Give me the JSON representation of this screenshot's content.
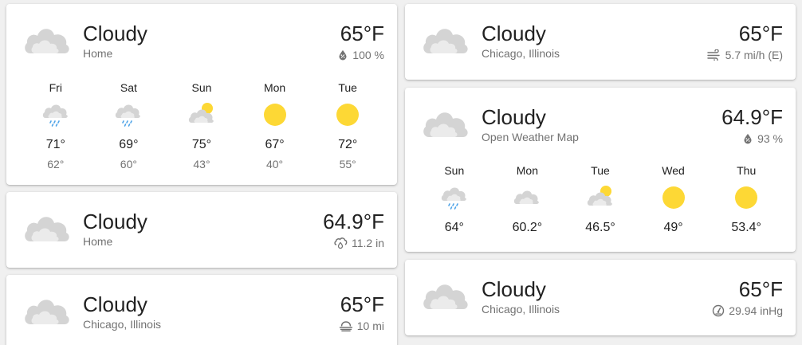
{
  "cards": {
    "c1": {
      "condition": "Cloudy",
      "location": "Home",
      "temperature": "65°F",
      "attribute": {
        "icon": "humidity-icon",
        "value": "100 %"
      },
      "forecast": [
        {
          "day": "Fri",
          "icon": "rainy-icon",
          "high": "71°",
          "low": "62°"
        },
        {
          "day": "Sat",
          "icon": "rainy-icon",
          "high": "69°",
          "low": "60°"
        },
        {
          "day": "Sun",
          "icon": "partly-cloudy-icon",
          "high": "75°",
          "low": "43°"
        },
        {
          "day": "Mon",
          "icon": "sunny-icon",
          "high": "67°",
          "low": "40°"
        },
        {
          "day": "Tue",
          "icon": "sunny-icon",
          "high": "72°",
          "low": "55°"
        }
      ]
    },
    "c2": {
      "condition": "Cloudy",
      "location": "Home",
      "temperature": "64.9°F",
      "attribute": {
        "icon": "rain-gauge-icon",
        "value": "11.2 in"
      }
    },
    "c3": {
      "condition": "Cloudy",
      "location": "Chicago, Illinois",
      "temperature": "65°F",
      "attribute": {
        "icon": "visibility-fog-icon",
        "value": "10 mi"
      }
    },
    "c4": {
      "condition": "Cloudy",
      "location": "Chicago, Illinois",
      "temperature": "65°F",
      "attribute": {
        "icon": "wind-icon",
        "value": "5.7 mi/h (E)"
      }
    },
    "c5": {
      "condition": "Cloudy",
      "location": "Open Weather Map",
      "temperature": "64.9°F",
      "attribute": {
        "icon": "humidity-icon",
        "value": "93 %"
      },
      "forecast": [
        {
          "day": "Sun",
          "icon": "rainy-icon",
          "high": "64°"
        },
        {
          "day": "Mon",
          "icon": "cloudy-icon",
          "high": "60.2°"
        },
        {
          "day": "Tue",
          "icon": "partly-cloudy-icon",
          "high": "46.5°"
        },
        {
          "day": "Wed",
          "icon": "sunny-icon",
          "high": "49°"
        },
        {
          "day": "Thu",
          "icon": "sunny-icon",
          "high": "53.4°"
        }
      ]
    },
    "c6": {
      "condition": "Cloudy",
      "location": "Chicago, Illinois",
      "temperature": "65°F",
      "attribute": {
        "icon": "pressure-gauge-icon",
        "value": "29.94 inHg"
      }
    }
  },
  "colors": {
    "cloud": "#d4d4d4",
    "cloud_light": "#e8e8e8",
    "sun": "#fdd835",
    "rain": "#4fa4e8",
    "secondary_text": "#727272"
  }
}
